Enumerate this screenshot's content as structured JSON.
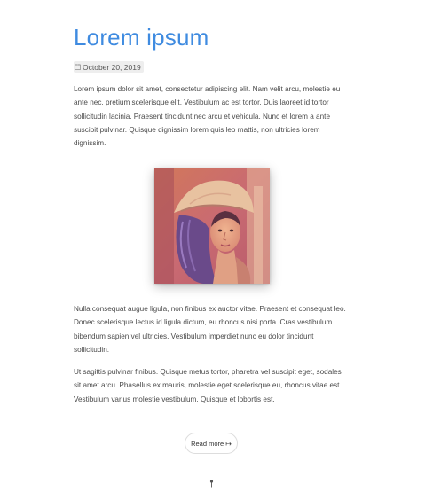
{
  "post": {
    "title": "Lorem ipsum",
    "date": "October 20, 2019",
    "date_icon": "calendar-icon",
    "paragraphs": [
      "Lorem ipsum dolor sit amet, consectetur adipiscing elit. Nam velit arcu, molestie eu ante nec, pretium scelerisque elit. Vestibulum ac est tortor. Duis laoreet id tortor sollicitudin lacinia. Praesent tincidunt nec arcu et vehicula. Nunc et lorem a ante suscipit pulvinar. Quisque dignissim lorem quis leo mattis, non ultricies lorem dignissim.",
      "Nulla consequat augue ligula, non finibus ex auctor vitae. Praesent et consequat leo. Donec scelerisque lectus id ligula dictum, eu rhoncus nisi porta. Cras vestibulum bibendum sapien vel ultricies. Vestibulum imperdiet nunc eu dolor tincidunt sollicitudin.",
      "Ut sagittis pulvinar finibus. Quisque metus tortor, pharetra vel suscipit eget, sodales sit amet arcu. Phasellus ex mauris, molestie eget scelerisque eu, rhoncus vitae est. Vestibulum varius molestie vestibulum. Quisque et lobortis est."
    ],
    "read_more_label": "Read more",
    "read_more_icon": "long-arrow-right-icon",
    "footer_icon": "pin-icon"
  },
  "colors": {
    "title": "#3f8be0",
    "text": "#4a4a4a",
    "meta_background": "#eeeeee"
  }
}
